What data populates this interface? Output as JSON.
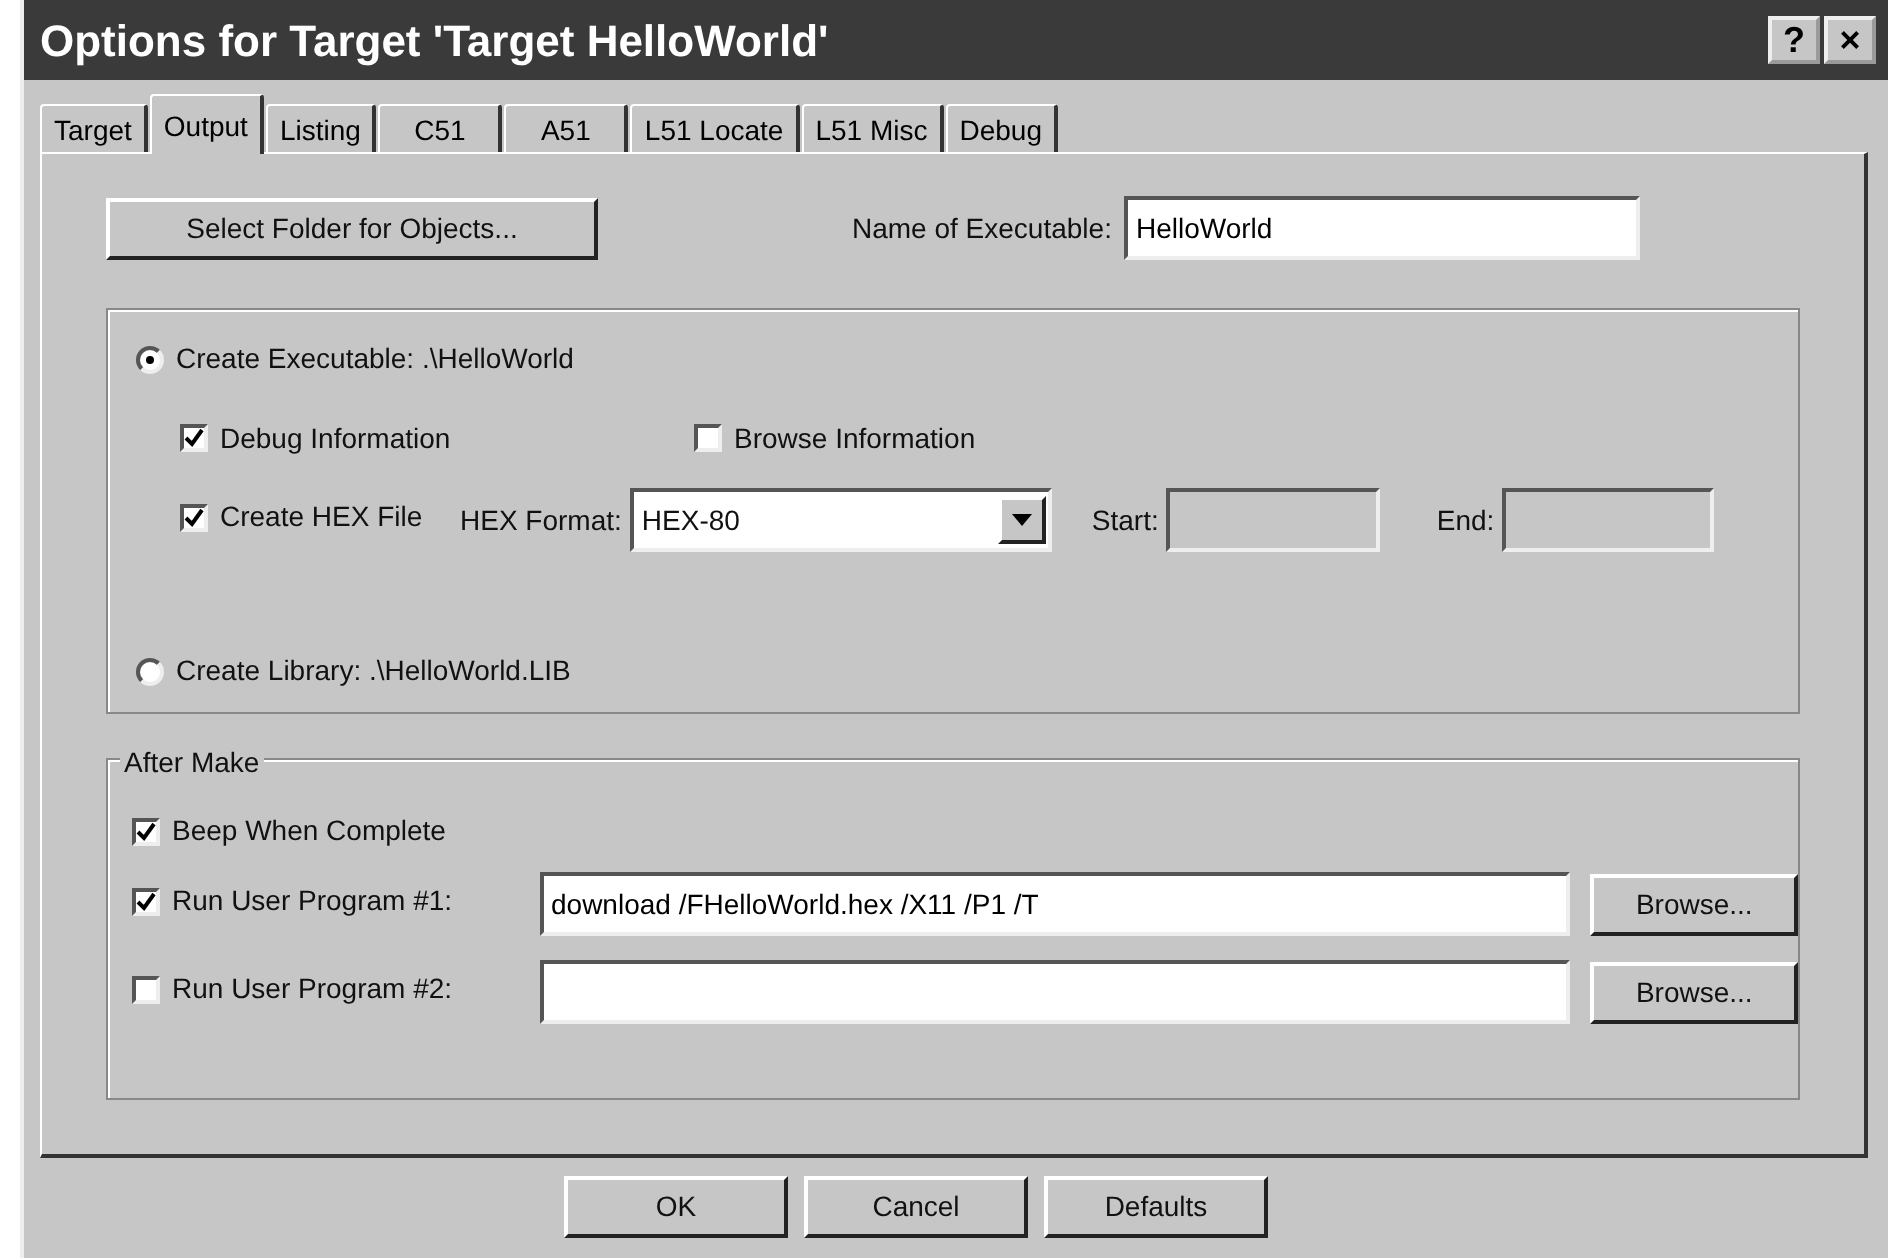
{
  "window": {
    "title": "Options for Target 'Target HelloWorld'",
    "title_buttons": [
      "?",
      "×"
    ]
  },
  "tabs": [
    {
      "label": "Target",
      "selected": false
    },
    {
      "label": "Output",
      "selected": true
    },
    {
      "label": "Listing",
      "selected": false
    },
    {
      "label": "C51",
      "selected": false
    },
    {
      "label": "A51",
      "selected": false
    },
    {
      "label": "L51 Locate",
      "selected": false
    },
    {
      "label": "L51 Misc",
      "selected": false
    },
    {
      "label": "Debug",
      "selected": false
    }
  ],
  "output": {
    "select_folder_button": "Select Folder for Objects...",
    "name_of_executable": {
      "label": "Name of Executable:",
      "value": "HelloWorld"
    },
    "create_executable": {
      "label": "Create Executable:  .\\HelloWorld",
      "selected": true
    },
    "debug_information": {
      "label": "Debug Information",
      "checked": true
    },
    "browse_information": {
      "label": "Browse Information",
      "checked": false
    },
    "create_hex_file": {
      "label": "Create HEX File",
      "checked": true
    },
    "hex_format": {
      "label": "HEX Format:",
      "value": "HEX-80"
    },
    "start": {
      "label": "Start:",
      "disabled": true
    },
    "end": {
      "label": "End:",
      "disabled": true
    },
    "create_library": {
      "label": "Create Library:  .\\HelloWorld.LIB",
      "selected": false
    }
  },
  "after_make": {
    "title": "After Make",
    "items": [
      {
        "kind": "checkbox",
        "label": "Beep When Complete",
        "checked": true
      },
      {
        "kind": "program",
        "label": "Run User Program #1:",
        "checked": true,
        "value": "download /FHelloWorld.hex /X11 /P1 /T",
        "button": "Browse..."
      },
      {
        "kind": "program",
        "label": "Run User Program #2:",
        "checked": false,
        "button": "Browse..."
      }
    ]
  },
  "buttons": [
    "OK",
    "Cancel",
    "Defaults"
  ]
}
